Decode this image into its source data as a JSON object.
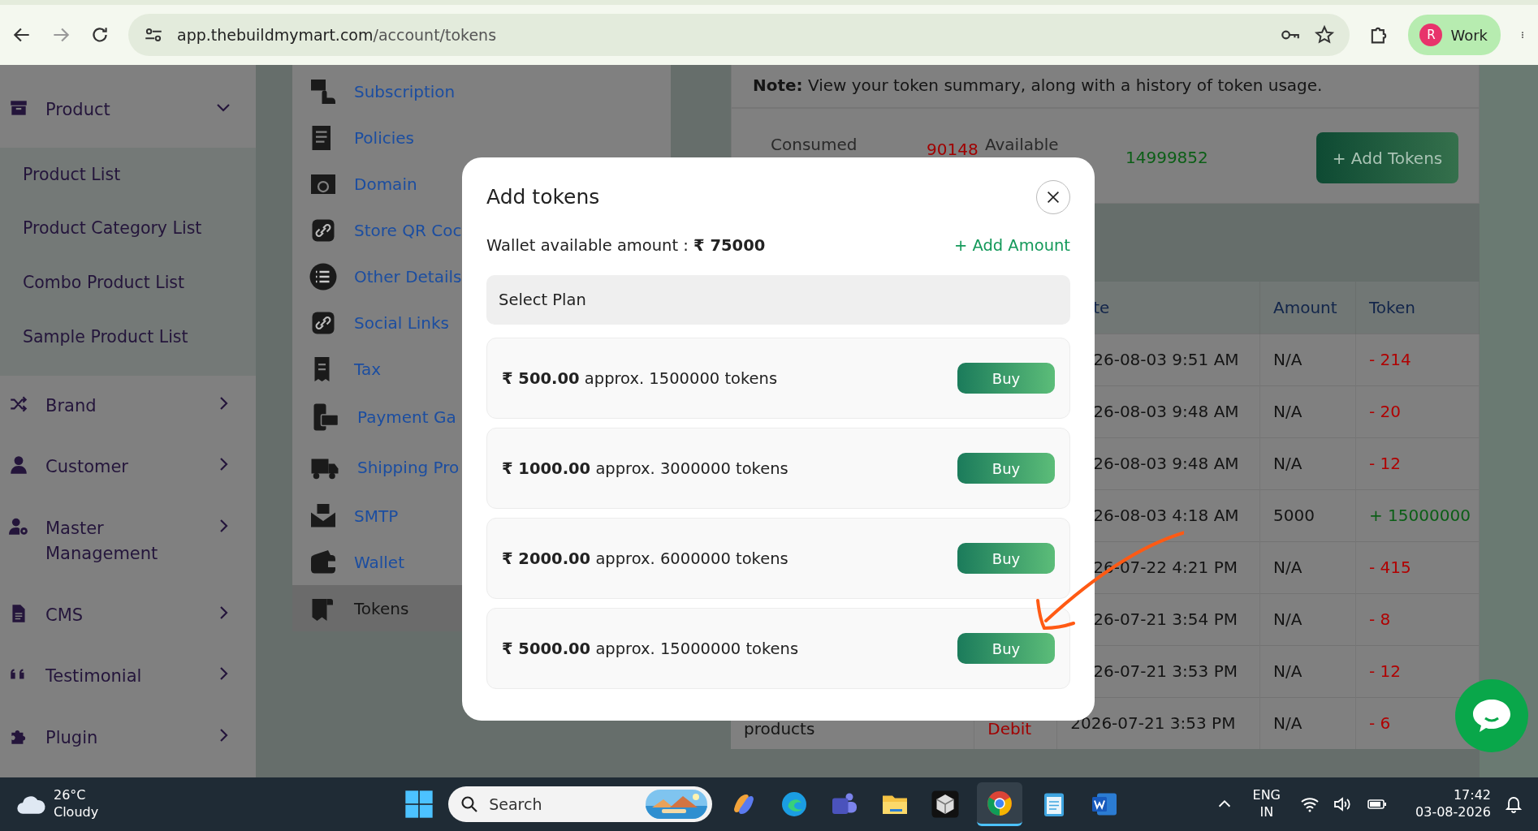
{
  "browser": {
    "url_host": "app.thebuildmymart.com",
    "url_path": "/account/tokens",
    "profile_initial": "R",
    "profile_label": "Work"
  },
  "sidebar": {
    "items": [
      {
        "label": "Product",
        "expanded": true,
        "children": [
          {
            "label": "Product List"
          },
          {
            "label": "Product Category List"
          },
          {
            "label": "Combo Product List"
          },
          {
            "label": "Sample Product List"
          }
        ]
      },
      {
        "label": "Brand",
        "expanded": false
      },
      {
        "label": "Customer",
        "expanded": false
      },
      {
        "label": "Master Management",
        "expanded": false
      },
      {
        "label": "CMS",
        "expanded": false
      },
      {
        "label": "Testimonial",
        "expanded": false
      },
      {
        "label": "Plugin",
        "expanded": false
      }
    ]
  },
  "settings_menu": {
    "items": [
      {
        "label": "Subscription",
        "selected": false
      },
      {
        "label": "Policies",
        "selected": false
      },
      {
        "label": "Domain",
        "selected": false
      },
      {
        "label": "Store QR Coc",
        "selected": false
      },
      {
        "label": "Other Details",
        "selected": false
      },
      {
        "label": "Social Links",
        "selected": false
      },
      {
        "label": "Tax",
        "selected": false
      },
      {
        "label": "Payment Ga",
        "selected": false
      },
      {
        "label": "Shipping Pro",
        "selected": false
      },
      {
        "label": "SMTP",
        "selected": false
      },
      {
        "label": "Wallet",
        "selected": false
      },
      {
        "label": "Tokens",
        "selected": true
      }
    ]
  },
  "note": "**Note:** View your token summary, along with a history of token usage.",
  "summary": {
    "consumed_label": "Consumed",
    "consumed_value": "90148",
    "available_label": "Available",
    "available_value": "14999852",
    "add_button": "+ Add Tokens"
  },
  "table": {
    "columns": [
      "te",
      "Amount",
      "Token"
    ],
    "rows": [
      {
        "date": "26-08-03 9:51 AM",
        "amount": "N/A",
        "token": "- 214",
        "color": "#b00000"
      },
      {
        "date": "26-08-03 9:48 AM",
        "amount": "N/A",
        "token": "- 20",
        "color": "#b00000"
      },
      {
        "date": "26-08-03 9:48 AM",
        "amount": "N/A",
        "token": "- 12",
        "color": "#b00000"
      },
      {
        "date": "26-08-03 4:18 AM",
        "amount": "5000",
        "token": "+ 15000000",
        "color": "#0b5e16"
      },
      {
        "date": "26-07-22 4:21 PM",
        "amount": "N/A",
        "token": "- 415",
        "color": "#b00000"
      },
      {
        "date": "26-07-21 3:54 PM",
        "amount": "N/A",
        "token": "- 8",
        "color": "#b00000"
      },
      {
        "date": "26-07-21 3:53 PM",
        "amount": "N/A",
        "token": "- 12",
        "color": "#b00000"
      },
      {
        "description": "products",
        "type": "Debit",
        "date": "2026-07-21 3:53 PM",
        "amount": "N/A",
        "token": "- 6",
        "color": "#b00000"
      }
    ]
  },
  "modal": {
    "title": "Add tokens",
    "wallet": "Wallet available amount : **₹ 75000**",
    "add_amount": "+ Add Amount",
    "select_label": "Select Plan",
    "plans": [
      {
        "text": "**₹ 500.00** approx. 1500000 tokens",
        "button": "Buy"
      },
      {
        "text": "**₹ 1000.00** approx. 3000000 tokens",
        "button": "Buy"
      },
      {
        "text": "**₹ 2000.00** approx. 6000000 tokens",
        "button": "Buy"
      },
      {
        "text": "**₹ 5000.00** approx. 15000000 tokens",
        "button": "Buy"
      }
    ]
  },
  "taskbar": {
    "temperature": "26°C",
    "weather": "Cloudy",
    "search_placeholder": "Search",
    "language": "ENG",
    "region": "IN",
    "time": "17:42",
    "date": "03-08-2026"
  }
}
